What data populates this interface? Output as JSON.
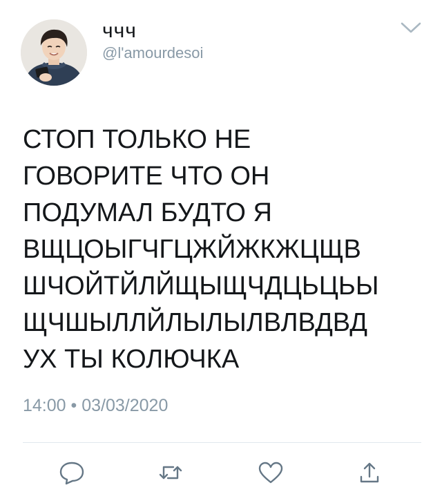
{
  "author": {
    "display_name": "ччч",
    "handle": "@l'amourdesoi",
    "avatar_icon": "profile-photo"
  },
  "tweet": {
    "text": "СТОП ТОЛЬКО НЕ\nГОВОРИТЕ ЧТО ОН\nПОДУМАЛ БУДТО Я\nВЩЦОЫГЧГЦЖЙЖКЖЦЩВ\nШЧОЙТЙЛЙЩЫЩЧДЦЬЦЬЫ\nЩЧШЫЛЛЙЛЫЛЫЛВЛВДВД\nУХ ТЫ КОЛЮЧКА",
    "time": "14:00",
    "separator": "•",
    "date": "03/03/2020"
  },
  "actions": {
    "reply_icon": "reply-icon",
    "retweet_icon": "retweet-icon",
    "like_icon": "heart-icon",
    "share_icon": "share-icon"
  },
  "colors": {
    "text": "#14171a",
    "muted": "#8899a6",
    "divider": "#e1e8ed"
  }
}
